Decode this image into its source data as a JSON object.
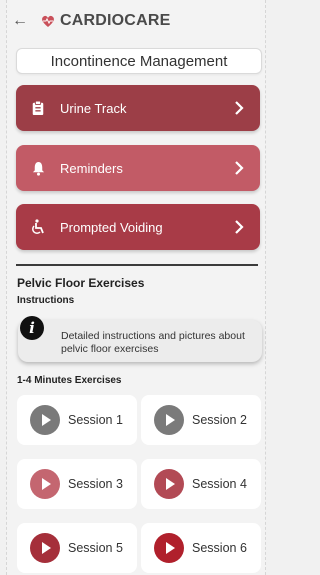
{
  "header": {
    "back_icon": "back-arrow-icon",
    "brand_icon": "heart-icon",
    "brand": "CARDIOCARE"
  },
  "page_title": "Incontinence Management",
  "menu": [
    {
      "label": "Urine Track",
      "icon": "clipboard-icon",
      "color": "#9c3e47"
    },
    {
      "label": "Reminders",
      "icon": "bell-icon",
      "color": "#c25b66"
    },
    {
      "label": "Prompted Voiding",
      "icon": "wheelchair-icon",
      "color": "#a83b47"
    }
  ],
  "pelvic": {
    "title": "Pelvic Floor Exercises",
    "instructions_label": "Instructions",
    "info_icon_text": "i",
    "info_text": "Detailed instructions and pictures about pelvic floor exercises",
    "exercises_title": "1-4 Minutes Exercises",
    "sessions": [
      {
        "label": "Session 1",
        "color": "#7a7a7a"
      },
      {
        "label": "Session 2",
        "color": "#7a7a7a"
      },
      {
        "label": "Session 3",
        "color": "#c46670"
      },
      {
        "label": "Session 4",
        "color": "#b24a55"
      },
      {
        "label": "Session 5",
        "color": "#a52f3a"
      },
      {
        "label": "Session 6",
        "color": "#b0202c"
      }
    ]
  }
}
